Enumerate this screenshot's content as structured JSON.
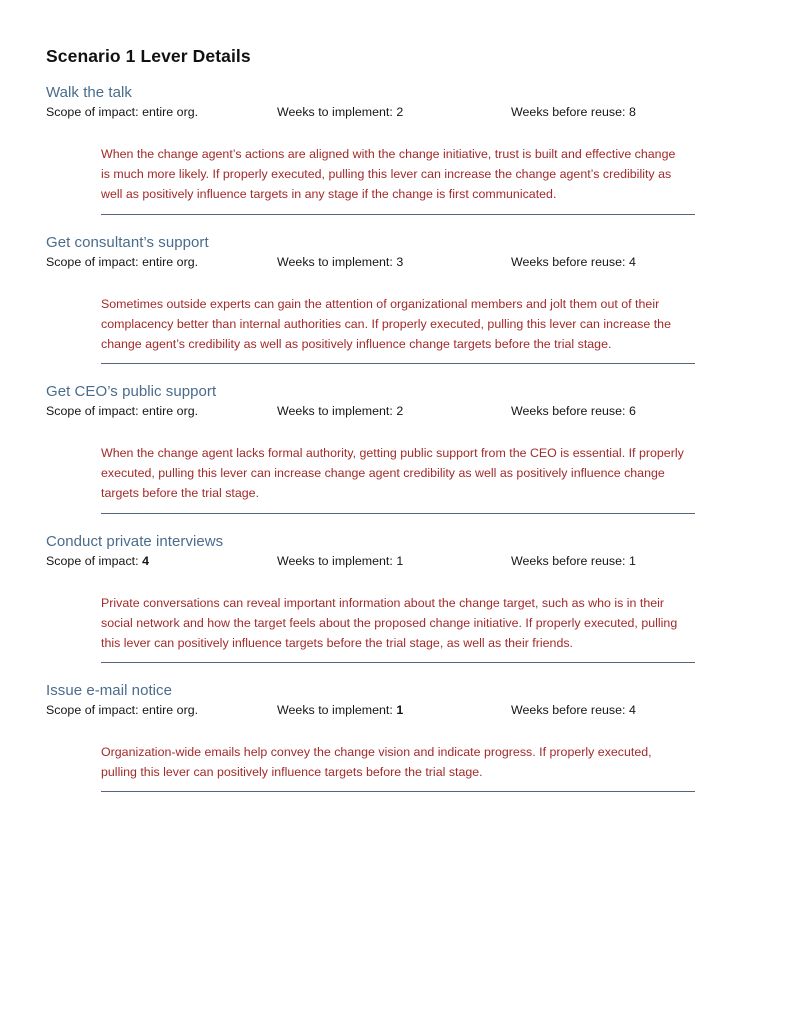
{
  "document": {
    "title": "Scenario 1 Lever Details",
    "heading_color": "#4a6c8c",
    "body_color": "#a32a2a",
    "divider_color": "#56657a"
  },
  "labels": {
    "scope": "Scope of impact:",
    "weeks_to_implement": "Weeks to implement:",
    "weeks_before_reuse": "Weeks before reuse:"
  },
  "levers": [
    {
      "name": "Walk the talk",
      "scope_value": "entire org.",
      "scope_bold": false,
      "weeks_to_implement": "2",
      "weeks_to_implement_bold": false,
      "weeks_before_reuse": "8",
      "description": "When the change agent’s actions are aligned with the change initiative, trust is built and effective change is much more likely. If properly executed, pulling this lever can increase the change agent’s credibility as well as positively influence targets in any stage if the change is first communicated."
    },
    {
      "name": "Get consultant’s support",
      "scope_value": "entire org.",
      "scope_bold": false,
      "weeks_to_implement": "3",
      "weeks_to_implement_bold": false,
      "weeks_before_reuse": "4",
      "description": "Sometimes outside experts can gain the attention of organizational members and jolt them out of their complacency better than internal authorities can. If properly executed, pulling this lever can increase the change agent’s credibility as well as positively influence change targets before the trial stage."
    },
    {
      "name": "Get CEO’s public support",
      "scope_value": "entire org.",
      "scope_bold": false,
      "weeks_to_implement": "2",
      "weeks_to_implement_bold": false,
      "weeks_before_reuse": "6",
      "description": "When the change agent lacks formal authority, getting public support from the CEO is essential. If properly executed, pulling this lever can increase change agent credibility as well as positively influence change targets before the trial stage."
    },
    {
      "name": "Conduct private interviews",
      "scope_value": "4",
      "scope_bold": true,
      "weeks_to_implement": "1",
      "weeks_to_implement_bold": false,
      "weeks_before_reuse": "1",
      "description": "Private conversations can reveal important information about the change target, such as who is in their social network and how the target feels about the proposed change initiative. If properly executed, pulling this lever can positively influence targets before the trial stage, as well as their friends."
    },
    {
      "name": "Issue e-mail notice",
      "scope_value": "entire org.",
      "scope_bold": false,
      "weeks_to_implement": "1",
      "weeks_to_implement_bold": true,
      "weeks_before_reuse": "4",
      "description": "Organization-wide emails help convey the change vision and indicate progress. If properly executed, pulling this lever can positively influence targets before the trial stage."
    }
  ]
}
